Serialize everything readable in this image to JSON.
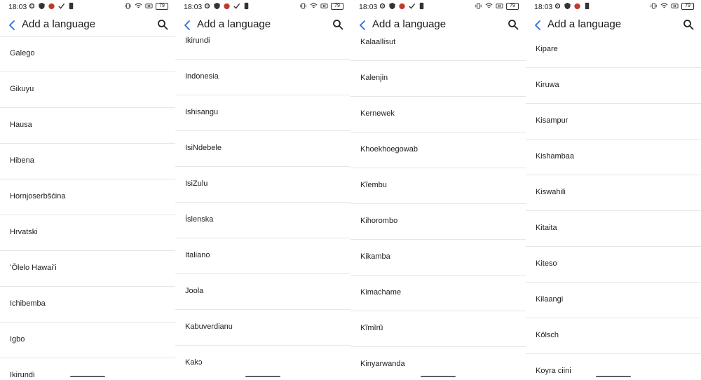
{
  "status": {
    "time": "18:03",
    "battery": "79"
  },
  "app_bar": {
    "title": "Add a language"
  },
  "screens": [
    {
      "items": [
        "Galego",
        "Gikuyu",
        "Hausa",
        "Hibena",
        "Hornjoserbšćina",
        "Hrvatski",
        "ʻŌlelo Hawaiʻi",
        "Ichibemba",
        "Igbo",
        "Ikirundi"
      ]
    },
    {
      "items": [
        "Ikirundi",
        "Indonesia",
        "Ishisangu",
        "IsiNdebele",
        "IsiZulu",
        "Íslenska",
        "Italiano",
        "Joola",
        "Kabuverdianu",
        "Kakɔ"
      ]
    },
    {
      "items": [
        "Kalaallisut",
        "Kalenjin",
        "Kernewek",
        "Khoekhoegowab",
        "Kĩembu",
        "Kihorombo",
        "Kikamba",
        "Kimachame",
        "Kĩmĩrũ",
        "Kinyarwanda"
      ]
    },
    {
      "items": [
        "Kipare",
        "Kiruwa",
        "Kisampur",
        "Kishambaa",
        "Kiswahili",
        "Kitaita",
        "Kiteso",
        "Kɨlaangi",
        "Kölsch",
        "Koyra ciini"
      ]
    }
  ]
}
